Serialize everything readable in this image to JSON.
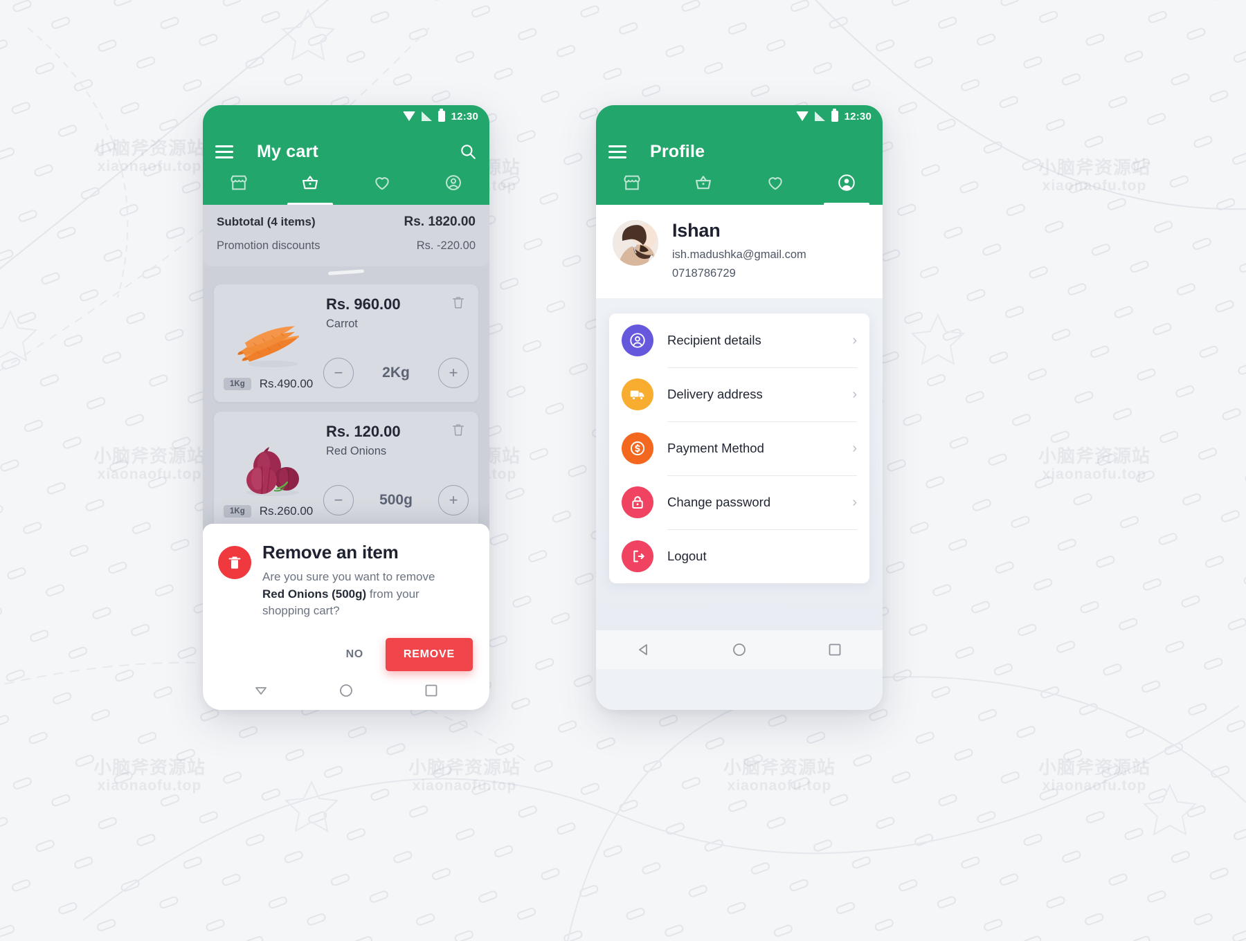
{
  "theme": {
    "brand_green": "#22a66b",
    "danger_red": "#f0454b",
    "purple": "#6558dd",
    "amber": "#f9ad30",
    "orange": "#f4671f",
    "pink": "#ef4361"
  },
  "watermark": {
    "line1": "小脑斧资源站",
    "line2": "xiaonaofu.top"
  },
  "cart_screen": {
    "status_bar": {
      "time": "12:30",
      "wifi_icon": "wifi-icon",
      "signal_icon": "signal-icon",
      "battery_icon": "battery-icon"
    },
    "appbar": {
      "menu_icon": "hamburger-menu-icon",
      "title": "My cart",
      "search_icon": "search-icon"
    },
    "tabs": [
      {
        "name": "store",
        "icon": "store-icon",
        "active": false
      },
      {
        "name": "cart",
        "icon": "basket-icon",
        "active": true
      },
      {
        "name": "favourites",
        "icon": "heart-icon",
        "active": false
      },
      {
        "name": "profile",
        "icon": "account-circle-icon",
        "active": false
      }
    ],
    "summary": [
      {
        "label": "Subtotal (4 items)",
        "value": "Rs. 1820.00",
        "emphasis": true
      },
      {
        "label": "Promotion discounts",
        "value": "Rs. -220.00",
        "emphasis": false
      }
    ],
    "items": [
      {
        "name": "Carrot",
        "price": "Rs. 960.00",
        "unit_badge": "1Kg",
        "unit_price": "Rs.490.00",
        "quantity": "2Kg",
        "image": "carrot-image",
        "decrease_label": "−",
        "increase_label": "+",
        "delete_icon": "trash-icon"
      },
      {
        "name": "Red Onions",
        "price": "Rs. 120.00",
        "unit_badge": "1Kg",
        "unit_price": "Rs.260.00",
        "quantity": "500g",
        "image": "red-onions-image",
        "decrease_label": "−",
        "increase_label": "+",
        "delete_icon": "trash-icon"
      }
    ],
    "dialog": {
      "icon": "trash-icon",
      "title": "Remove an item",
      "text_before": "Are you sure you want to remove ",
      "text_item": "Red Onions (500g)",
      "text_after": " from your shopping cart?",
      "cancel_label": "NO",
      "confirm_label": "REMOVE"
    },
    "nav_bar": {
      "back": "back-triangle-icon",
      "home": "home-circle-icon",
      "recents": "recents-square-icon"
    }
  },
  "profile_screen": {
    "status_bar": {
      "time": "12:30",
      "wifi_icon": "wifi-icon",
      "signal_icon": "signal-icon",
      "battery_icon": "battery-icon"
    },
    "appbar": {
      "menu_icon": "hamburger-menu-icon",
      "title": "Profile"
    },
    "tabs": [
      {
        "name": "store",
        "icon": "store-icon",
        "active": false
      },
      {
        "name": "cart",
        "icon": "basket-icon",
        "active": false
      },
      {
        "name": "favourites",
        "icon": "heart-icon",
        "active": false
      },
      {
        "name": "profile",
        "icon": "account-circle-icon",
        "active": true
      }
    ],
    "user": {
      "avatar": "user-avatar",
      "name": "Ishan",
      "email": "ish.madushka@gmail.com",
      "phone": "0718786729"
    },
    "menu": [
      {
        "label": "Recipient details",
        "icon": "account-circle-icon",
        "color": "#6558dd",
        "chevron": "›"
      },
      {
        "label": "Delivery address",
        "icon": "truck-icon",
        "color": "#f9ad30",
        "chevron": "›"
      },
      {
        "label": "Payment Method",
        "icon": "dollar-coin-icon",
        "color": "#f4671f",
        "chevron": "›"
      },
      {
        "label": "Change password",
        "icon": "lock-icon",
        "color": "#ef4361",
        "chevron": "›"
      },
      {
        "label": "Logout",
        "icon": "logout-icon",
        "color": "#ef4361",
        "chevron": ""
      }
    ],
    "nav_bar": {
      "back": "back-triangle-icon",
      "home": "home-circle-icon",
      "recents": "recents-square-icon"
    }
  }
}
